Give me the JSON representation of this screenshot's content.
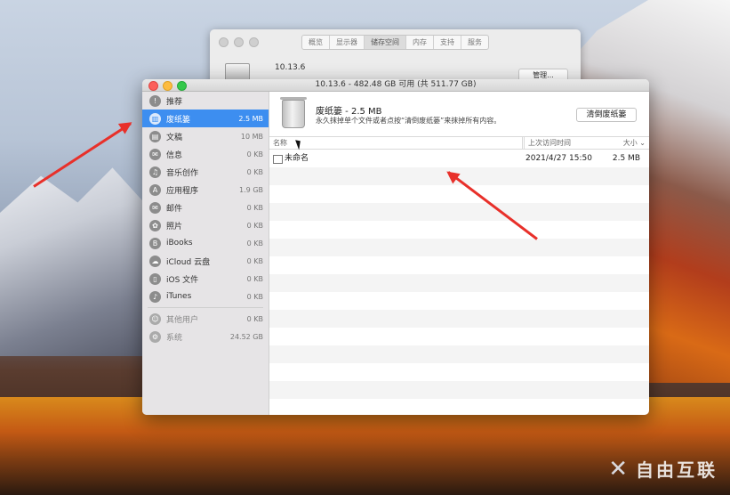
{
  "background_window": {
    "tabs": [
      "概览",
      "显示器",
      "储存空间",
      "内存",
      "支持",
      "服务"
    ],
    "active_tab": 2,
    "version": "10.13.6",
    "manage_button": "管理..."
  },
  "window": {
    "title": "10.13.6 - 482.48 GB 可用 (共 511.77 GB)"
  },
  "sidebar": {
    "items": [
      {
        "label": "推荐",
        "size": "",
        "icon": "recommend-icon",
        "glyph": "!"
      },
      {
        "label": "废纸篓",
        "size": "2.5 MB",
        "icon": "trash-icon",
        "glyph": "▥",
        "selected": true
      },
      {
        "label": "文稿",
        "size": "10 MB",
        "icon": "document-icon",
        "glyph": "▤"
      },
      {
        "label": "信息",
        "size": "0 KB",
        "icon": "messages-icon",
        "glyph": "✉"
      },
      {
        "label": "音乐创作",
        "size": "0 KB",
        "icon": "music-creation-icon",
        "glyph": "♫"
      },
      {
        "label": "应用程序",
        "size": "1.9 GB",
        "icon": "applications-icon",
        "glyph": "A"
      },
      {
        "label": "邮件",
        "size": "0 KB",
        "icon": "mail-icon",
        "glyph": "✉"
      },
      {
        "label": "照片",
        "size": "0 KB",
        "icon": "photos-icon",
        "glyph": "✿"
      },
      {
        "label": "iBooks",
        "size": "0 KB",
        "icon": "ibooks-icon",
        "glyph": "B"
      },
      {
        "label": "iCloud 云盘",
        "size": "0 KB",
        "icon": "icloud-icon",
        "glyph": "☁"
      },
      {
        "label": "iOS 文件",
        "size": "0 KB",
        "icon": "ios-files-icon",
        "glyph": "▯"
      },
      {
        "label": "iTunes",
        "size": "0 KB",
        "icon": "itunes-icon",
        "glyph": "♪"
      }
    ],
    "other_items": [
      {
        "label": "其他用户",
        "size": "0 KB",
        "icon": "other-users-icon",
        "glyph": "☺"
      },
      {
        "label": "系统",
        "size": "24.52 GB",
        "icon": "system-icon",
        "glyph": "⚙"
      }
    ]
  },
  "header": {
    "title": "废纸篓 - 2.5 MB",
    "description": "永久抹掉单个文件或者点按“清倒废纸篓”来抹掉所有内容。",
    "empty_button": "清倒废纸篓"
  },
  "table": {
    "columns": {
      "name": "名称",
      "date": "上次访问时间",
      "size": "大小 ⌄"
    },
    "rows": [
      {
        "name": "未命名",
        "date": "2021/4/27 15:50",
        "size": "2.5 MB"
      }
    ],
    "empty_rows": 14
  },
  "watermark": "自由互联",
  "annotation_color": "#e8302a"
}
